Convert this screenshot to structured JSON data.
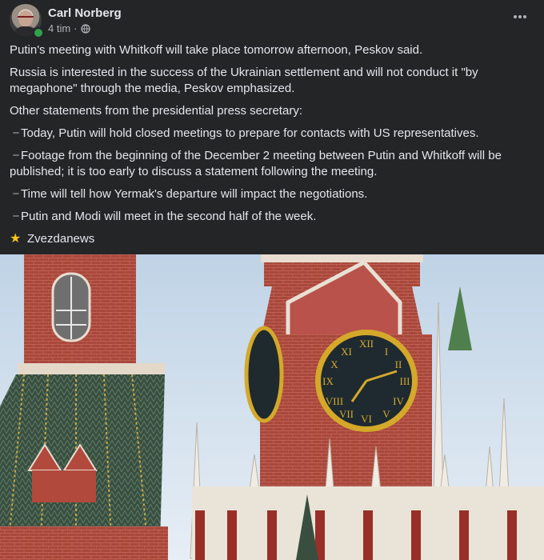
{
  "post": {
    "author": "Carl Norberg",
    "time": "4 tim",
    "separator": "·",
    "privacy_icon": "globe-icon",
    "more_icon": "more-dots-icon",
    "paragraphs": [
      "Putin's meeting with Whitkoff will take place tomorrow afternoon, Peskov said.",
      "Russia is interested in the success of the Ukrainian settlement and will not conduct it \"by megaphone\" through the media, Peskov emphasized.",
      "Other statements from the presidential press secretary:"
    ],
    "bullets": [
      "Today, Putin will hold closed meetings to prepare for contacts with US representatives.",
      "Footage from the beginning of the December 2 meeting between Putin and Whitkoff will be published; it is too early to discuss a statement following the meeting.",
      "Time will tell how Yermak's departure will impact the negotiations.",
      "Putin and Modi will meet in the second half of the week."
    ],
    "source": "Zvezdanews",
    "source_icon": "star-icon"
  },
  "colors": {
    "background": "#242526",
    "text": "#e4e6eb",
    "secondary": "#b0b3b8",
    "online": "#31a24c"
  }
}
